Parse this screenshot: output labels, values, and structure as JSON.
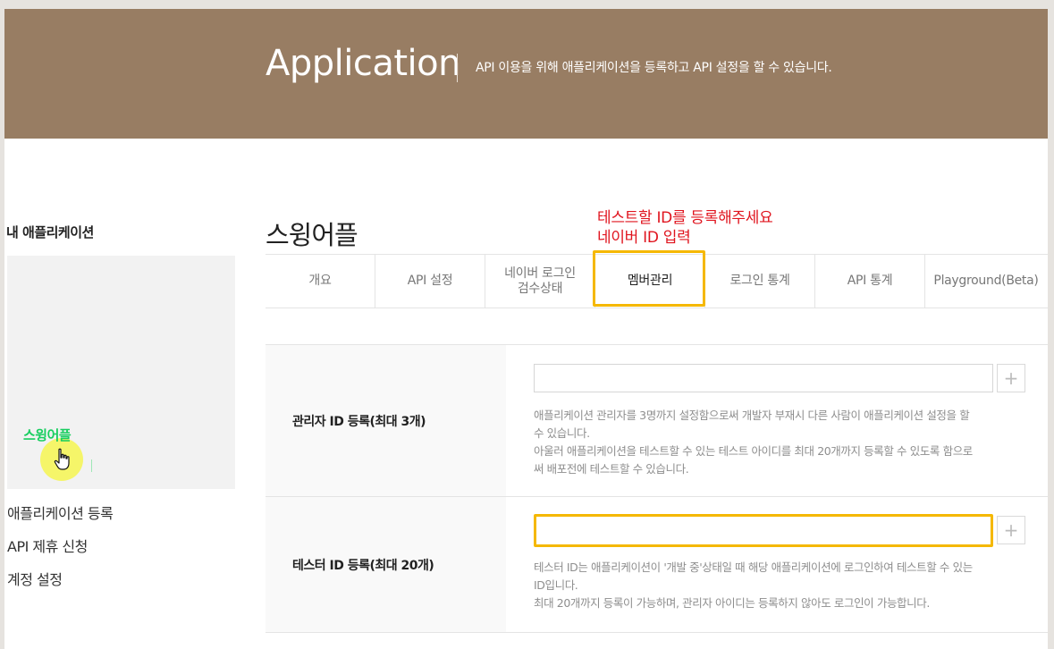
{
  "banner": {
    "title": "Application",
    "description": "API 이용을 위해 애플리케이션을 등록하고 API 설정을 할 수 있습니다."
  },
  "sidebar": {
    "heading": "내 애플리케이션",
    "apps": [
      {
        "label": "스윙어플"
      }
    ],
    "menu": [
      {
        "label": "애플리케이션 등록"
      },
      {
        "label": "API 제휴 신청"
      },
      {
        "label": "계정 설정"
      }
    ]
  },
  "main": {
    "app_name": "스윙어플",
    "annotation": {
      "line1": "테스트할 ID를 등록해주세요",
      "line2": "네이버 ID 입력"
    },
    "tabs": [
      {
        "label": "개요"
      },
      {
        "label": "API 설정"
      },
      {
        "label": "네이버 로그인\n검수상태"
      },
      {
        "label": "멤버관리",
        "active": true
      },
      {
        "label": "로그인 통계"
      },
      {
        "label": "API 통계"
      },
      {
        "label": "Playground(Beta)"
      }
    ],
    "rows": [
      {
        "label": "관리자 ID 등록(최대 3개)",
        "input_value": "",
        "plus": "+",
        "help": [
          "애플리케이션 관리자를 3명까지 설정함으로써 개발자 부재시 다른 사람이 애플리케이션 설정을 할",
          "수 있습니다.",
          "아울러 애플리케이션을 테스트할 수 있는 테스트 아이디를 최대 20개까지 등록할 수 있도록 함으로",
          "써 배포전에 테스트할 수 있습니다."
        ]
      },
      {
        "label": "테스터 ID 등록(최대 20개)",
        "input_value": "",
        "plus": "+",
        "help": [
          "테스터 ID는 애플리케이션이 '개발 중'상태일 때 해당 애플리케이션에 로그인하여 테스트할 수 있는",
          "ID입니다.",
          "최대 20개까지 등록이 가능하며, 관리자 아이디는 등록하지 않아도 로그인이 가능합니다."
        ]
      }
    ]
  },
  "colors": {
    "banner_bg": "#987d63",
    "highlight": "#f5b800",
    "annotation": "#e0141e",
    "app_link": "#19ce60",
    "cursor_highlight": "#f5f55a"
  },
  "icons": {
    "cursor": "hand-pointer-icon",
    "add": "plus-icon"
  }
}
